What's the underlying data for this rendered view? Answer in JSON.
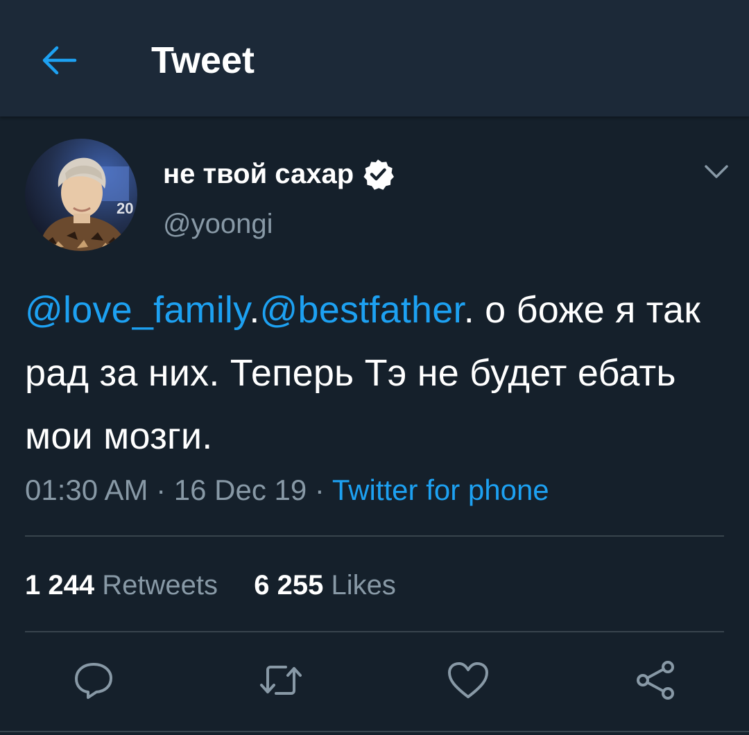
{
  "header": {
    "title": "Tweet",
    "back_icon": "arrow-left-icon"
  },
  "author": {
    "display_name": "не твой сахар",
    "handle": "@yoongi",
    "verified": true
  },
  "tweet": {
    "mention_1": "@love_family",
    "separator": ".",
    "mention_2": "@bestfather",
    "text": ". о боже я так рад за них. Теперь Тэ не будет ебать мои мозги."
  },
  "meta": {
    "time": "01:30 AM",
    "dot_1": " · ",
    "date": "16 Dec 19",
    "dot_2": " · ",
    "source": "Twitter for phone"
  },
  "stats": {
    "retweets_count": "1 244",
    "retweets_label": "Retweets",
    "likes_count": "6 255",
    "likes_label": "Likes"
  },
  "actions": [
    "reply-icon",
    "retweet-icon",
    "like-icon",
    "share-icon"
  ],
  "colors": {
    "background": "#15202b",
    "header": "#1c2938",
    "accent": "#1da1f2",
    "secondary_text": "#8899a6",
    "divider": "#38444d"
  }
}
